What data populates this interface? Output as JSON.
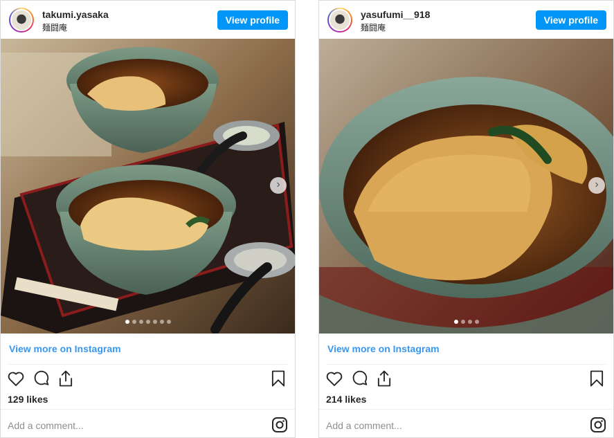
{
  "posts": [
    {
      "username": "takumi.yasaka",
      "location": "麺闘庵",
      "view_profile_label": "View profile",
      "view_more_label": "View more on Instagram",
      "likes": "129 likes",
      "comment_placeholder": "Add a comment...",
      "carousel_slide_count": 7,
      "carousel_active_index": 0
    },
    {
      "username": "yasufumi__918",
      "location": "麺闘庵",
      "view_profile_label": "View profile",
      "view_more_label": "View more on Instagram",
      "likes": "214 likes",
      "comment_placeholder": "Add a comment...",
      "carousel_slide_count": 4,
      "carousel_active_index": 0
    }
  ],
  "icons": {
    "like": "heart-icon",
    "comment": "comment-icon",
    "share": "share-icon",
    "save": "bookmark-icon",
    "instagram": "instagram-icon",
    "next": "chevron-right-icon"
  },
  "colors": {
    "accent": "#0095f6",
    "link": "#3897f0",
    "text": "#262626",
    "muted": "#8e8e8e",
    "border": "#dbdbdb"
  }
}
